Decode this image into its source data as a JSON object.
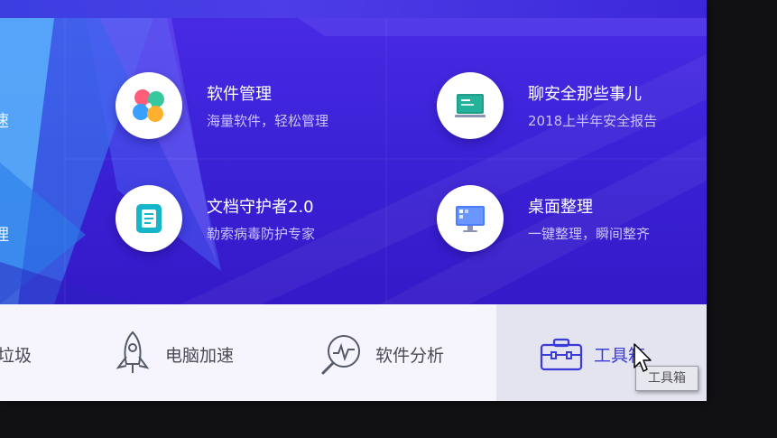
{
  "cards": [
    {
      "title": "软件管理",
      "subtitle": "海量软件，轻松管理",
      "icon": "clover-app-icon"
    },
    {
      "title": "聊安全那些事儿",
      "subtitle": "2018上半年安全报告",
      "icon": "blackboard-icon"
    },
    {
      "title": "文档守护者2.0",
      "subtitle": "勒索病毒防护专家",
      "icon": "document-icon"
    },
    {
      "title": "桌面整理",
      "subtitle": "一键整理，瞬间整齐",
      "icon": "monitor-icon"
    }
  ],
  "edge_fragments": {
    "row1": "速",
    "row2": "理"
  },
  "bottom_nav": [
    {
      "label": "垃圾",
      "icon": "trash-icon",
      "active": false
    },
    {
      "label": "电脑加速",
      "icon": "rocket-icon",
      "active": false
    },
    {
      "label": "软件分析",
      "icon": "magnifier-chart-icon",
      "active": false
    },
    {
      "label": "工具箱",
      "icon": "toolbox-icon",
      "active": true
    }
  ],
  "tooltip": "工具箱",
  "colors": {
    "panel": "#3a22d6",
    "bottom_bar": "#f6f5fd",
    "active_item": "#e4e4f1",
    "accent": "#3b3bd8"
  }
}
